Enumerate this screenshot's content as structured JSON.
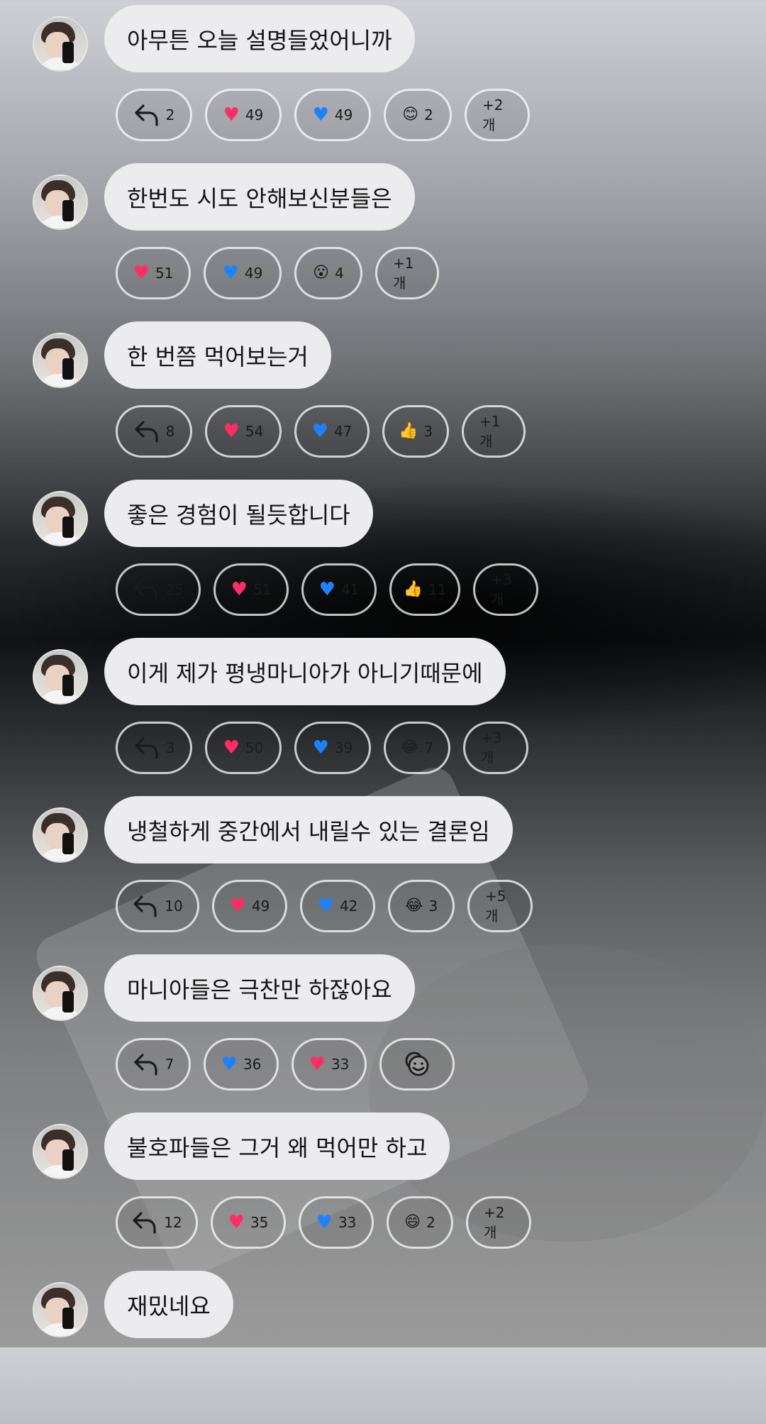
{
  "messages": [
    {
      "text": "아무튼 오늘 설명들었어니까",
      "reactions": [
        {
          "type": "reply",
          "icon": "reply-icon",
          "count": "2",
          "w": 108
        },
        {
          "type": "heart-red",
          "icon": "red-heart-icon",
          "count": "49",
          "w": 108
        },
        {
          "type": "heart-blue",
          "icon": "blue-heart-icon",
          "count": "49",
          "w": 108
        },
        {
          "type": "emoji",
          "icon": "smiling-face-icon",
          "glyph": "😊",
          "count": "2",
          "w": 96
        },
        {
          "type": "more",
          "label": "+2개",
          "w": 92
        }
      ]
    },
    {
      "text": "한번도 시도 안해보신분들은",
      "reactions": [
        {
          "type": "heart-red",
          "icon": "red-heart-icon",
          "count": "51",
          "w": 106
        },
        {
          "type": "heart-blue",
          "icon": "blue-heart-icon",
          "count": "49",
          "w": 110
        },
        {
          "type": "emoji",
          "icon": "astonished-face-icon",
          "glyph": "😮",
          "count": "4",
          "w": 96
        },
        {
          "type": "more",
          "label": "+1개",
          "w": 90
        }
      ]
    },
    {
      "text": "한 번쯤 먹어보는거",
      "reactions": [
        {
          "type": "reply",
          "icon": "reply-icon",
          "count": "8",
          "w": 108
        },
        {
          "type": "heart-red",
          "icon": "red-heart-icon",
          "count": "54",
          "w": 108
        },
        {
          "type": "heart-blue",
          "icon": "blue-heart-icon",
          "count": "47",
          "w": 106
        },
        {
          "type": "emoji",
          "icon": "thumbs-up-icon",
          "glyph": "👍",
          "count": "3",
          "w": 94
        },
        {
          "type": "more",
          "label": "+1개",
          "w": 90
        }
      ]
    },
    {
      "text": "좋은 경험이 될듯합니다",
      "reactions": [
        {
          "type": "reply",
          "icon": "reply-icon",
          "count": "25",
          "w": 120
        },
        {
          "type": "heart-red",
          "icon": "red-heart-icon",
          "count": "51",
          "w": 106
        },
        {
          "type": "heart-blue",
          "icon": "blue-heart-icon",
          "count": "41",
          "w": 106
        },
        {
          "type": "emoji",
          "icon": "thumbs-up-icon",
          "glyph": "👍",
          "count": "11",
          "w": 100
        },
        {
          "type": "more",
          "label": "+3개",
          "w": 92
        }
      ]
    },
    {
      "text": "이게 제가 평냉마니아가 아니기때문에",
      "reactions": [
        {
          "type": "reply",
          "icon": "reply-icon",
          "count": "3",
          "w": 108
        },
        {
          "type": "heart-red",
          "icon": "red-heart-icon",
          "count": "50",
          "w": 108
        },
        {
          "type": "heart-blue",
          "icon": "blue-heart-icon",
          "count": "39",
          "w": 108
        },
        {
          "type": "emoji",
          "icon": "tears-of-joy-icon",
          "glyph": "😂",
          "count": "7",
          "w": 94
        },
        {
          "type": "more",
          "label": "+3개",
          "w": 92
        }
      ]
    },
    {
      "text": "냉철하게 중간에서 내릴수 있는 결론임",
      "reactions": [
        {
          "type": "reply",
          "icon": "reply-icon",
          "count": "10",
          "w": 118
        },
        {
          "type": "heart-red",
          "icon": "red-heart-icon",
          "count": "49",
          "w": 106
        },
        {
          "type": "heart-blue",
          "icon": "blue-heart-icon",
          "count": "42",
          "w": 106
        },
        {
          "type": "emoji",
          "icon": "tears-of-joy-icon",
          "glyph": "😂",
          "count": "3",
          "w": 94
        },
        {
          "type": "more",
          "label": "+5개",
          "w": 92
        }
      ]
    },
    {
      "text": "마니아들은 극찬만 하잖아요",
      "reactions": [
        {
          "type": "reply",
          "icon": "reply-icon",
          "count": "7",
          "w": 106
        },
        {
          "type": "heart-blue",
          "icon": "blue-heart-icon",
          "count": "36",
          "w": 106
        },
        {
          "type": "heart-red",
          "icon": "red-heart-icon",
          "count": "33",
          "w": 106
        },
        {
          "type": "add",
          "icon": "add-reaction-icon",
          "w": 106
        }
      ]
    },
    {
      "text": "불호파들은 그거 왜 먹어만 하고",
      "reactions": [
        {
          "type": "reply",
          "icon": "reply-icon",
          "count": "12",
          "w": 116
        },
        {
          "type": "heart-red",
          "icon": "red-heart-icon",
          "count": "35",
          "w": 106
        },
        {
          "type": "heart-blue",
          "icon": "blue-heart-icon",
          "count": "33",
          "w": 106
        },
        {
          "type": "emoji",
          "icon": "grinning-face-icon",
          "glyph": "😄",
          "count": "2",
          "w": 94
        },
        {
          "type": "more",
          "label": "+2개",
          "w": 92
        }
      ]
    },
    {
      "text": "재밌네요",
      "reactions": []
    }
  ]
}
